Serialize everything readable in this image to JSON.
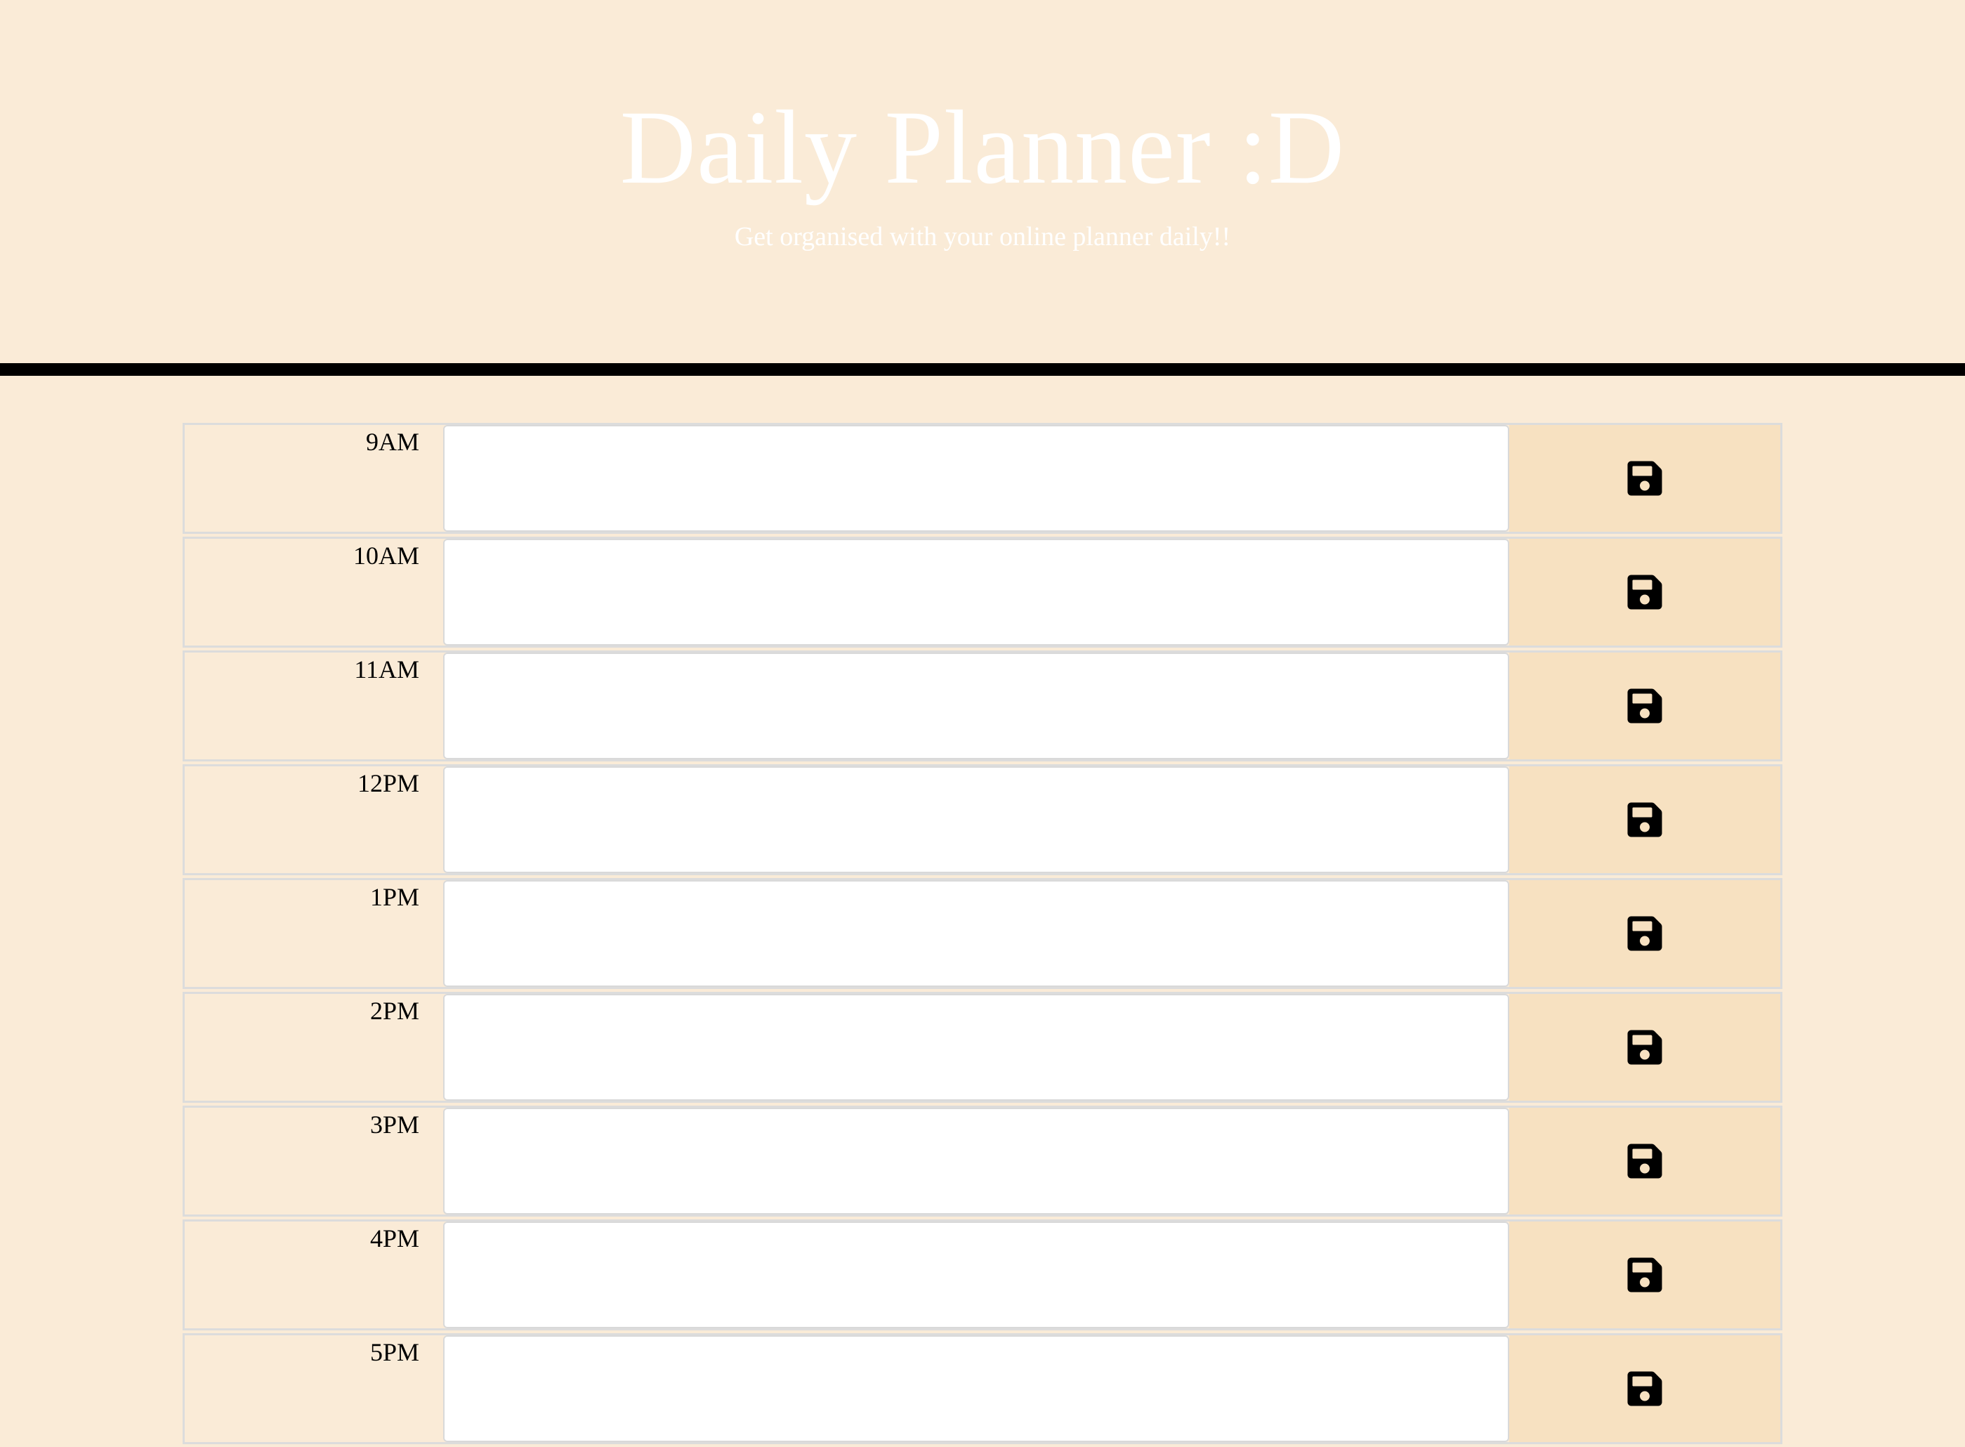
{
  "header": {
    "title": "Daily Planner :D",
    "subtitle": "Get organised with your online planner daily!!"
  },
  "colors": {
    "background": "#faebd7",
    "save_column": "#f7e1c1",
    "divider": "#000000",
    "text_entry": "#ffffff"
  },
  "planner": {
    "rows": [
      {
        "hour": "9AM",
        "text": "",
        "save_icon": "floppy-disk-icon"
      },
      {
        "hour": "10AM",
        "text": "",
        "save_icon": "floppy-disk-icon"
      },
      {
        "hour": "11AM",
        "text": "",
        "save_icon": "floppy-disk-icon"
      },
      {
        "hour": "12PM",
        "text": "",
        "save_icon": "floppy-disk-icon"
      },
      {
        "hour": "1PM",
        "text": "",
        "save_icon": "floppy-disk-icon"
      },
      {
        "hour": "2PM",
        "text": "",
        "save_icon": "floppy-disk-icon"
      },
      {
        "hour": "3PM",
        "text": "",
        "save_icon": "floppy-disk-icon"
      },
      {
        "hour": "4PM",
        "text": "",
        "save_icon": "floppy-disk-icon"
      },
      {
        "hour": "5PM",
        "text": "",
        "save_icon": "floppy-disk-icon"
      }
    ]
  }
}
